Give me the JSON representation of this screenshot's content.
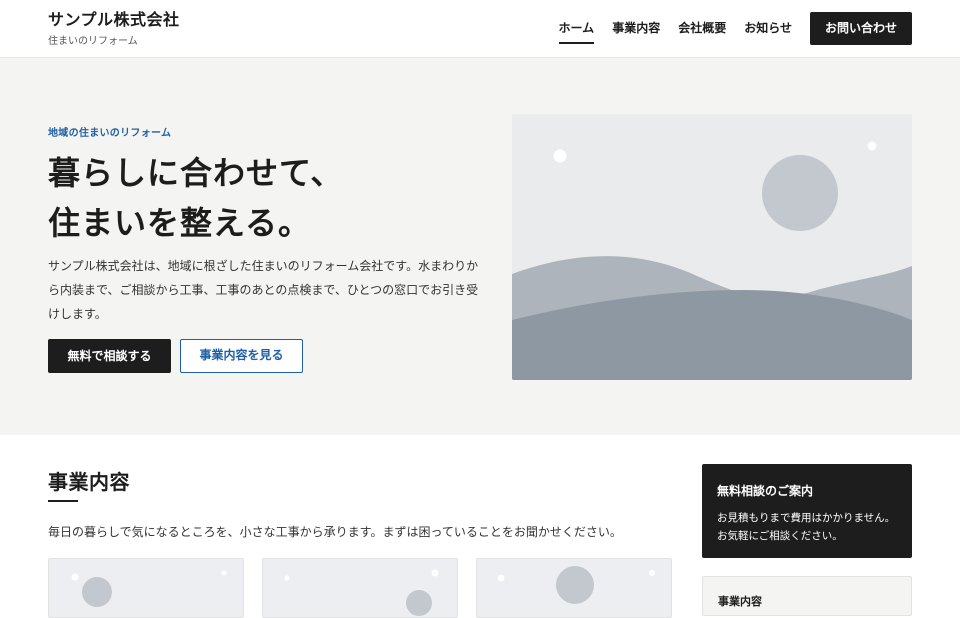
{
  "header": {
    "brand_name": "サンプル株式会社",
    "brand_sub": "住まいのリフォーム",
    "nav": [
      {
        "label": "ホーム",
        "active": true
      },
      {
        "label": "事業内容",
        "active": false
      },
      {
        "label": "会社概要",
        "active": false
      },
      {
        "label": "お知らせ",
        "active": false
      }
    ],
    "cta_label": "お問い合わせ"
  },
  "hero": {
    "tag": "地域の住まいのリフォーム",
    "title_line1": "暮らしに合わせて、",
    "title_line2": "住まいを整える。",
    "description": "サンプル株式会社は、地域に根ざした住まいのリフォーム会社です。水まわりから内装まで、ご相談から工事、工事のあとの点検まで、ひとつの窓口でお引き受けします。",
    "primary_button": "無料で相談する",
    "secondary_button": "事業内容を見る",
    "image_icon": "landscape-placeholder-image"
  },
  "services": {
    "title": "事業内容",
    "description": "毎日の暮らしで気になるところを、小さな工事から承ります。まずは困っていることをお聞かせください。"
  },
  "sidebar": {
    "consult_title": "無料相談のご案内",
    "consult_line1": "お見積もりまで費用はかかりません。",
    "consult_line2": "お気軽にご相談ください。",
    "box2_title": "事業内容"
  },
  "colors": {
    "accent": "#1f5fa6",
    "dark": "#1d1d1d",
    "hero_bg": "#f4f4f2"
  }
}
